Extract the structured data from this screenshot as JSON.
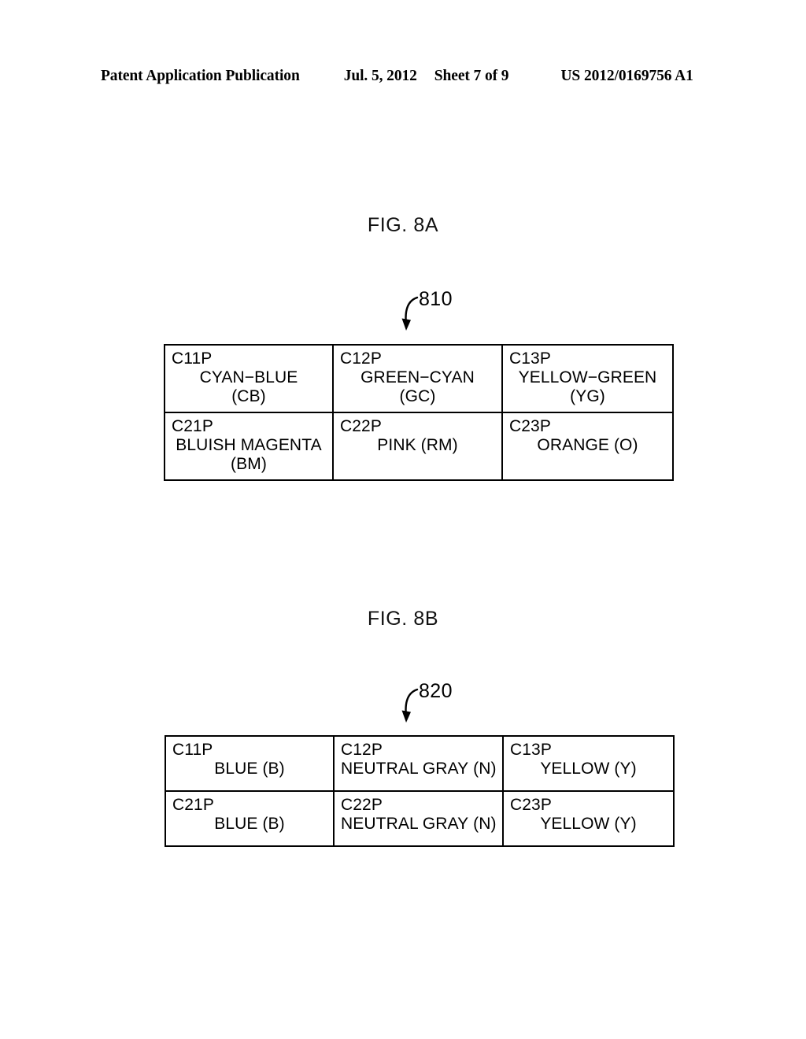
{
  "header": {
    "publication": "Patent Application Publication",
    "date": "Jul. 5, 2012",
    "sheet": "Sheet 7 of 9",
    "document_number": "US 2012/0169756 A1"
  },
  "figures": [
    {
      "title": "FIG. 8A",
      "reference_numeral": "810",
      "rows": [
        [
          {
            "code": "C11P",
            "value": "CYAN−BLUE",
            "abbr": "(CB)",
            "inline": false
          },
          {
            "code": "C12P",
            "value": "GREEN−CYAN",
            "abbr": "(GC)",
            "inline": false
          },
          {
            "code": "C13P",
            "value": "YELLOW−GREEN",
            "abbr": "(YG)",
            "inline": false
          }
        ],
        [
          {
            "code": "C21P",
            "value": "BLUISH MAGENTA",
            "abbr": "(BM)",
            "inline": false
          },
          {
            "code": "C22P",
            "value": "PINK",
            "abbr": "(RM)",
            "inline": true
          },
          {
            "code": "C23P",
            "value": "ORANGE",
            "abbr": "(O)",
            "inline": true
          }
        ]
      ]
    },
    {
      "title": "FIG. 8B",
      "reference_numeral": "820",
      "rows": [
        [
          {
            "code": "C11P",
            "value": "BLUE",
            "abbr": "(B)",
            "inline": true
          },
          {
            "code": "C12P",
            "value": "NEUTRAL GRAY",
            "abbr": "(N)",
            "inline": true
          },
          {
            "code": "C13P",
            "value": "YELLOW",
            "abbr": "(Y)",
            "inline": true
          }
        ],
        [
          {
            "code": "C21P",
            "value": "BLUE",
            "abbr": "(B)",
            "inline": true
          },
          {
            "code": "C22P",
            "value": "NEUTRAL GRAY",
            "abbr": "(N)",
            "inline": true
          },
          {
            "code": "C23P",
            "value": "YELLOW",
            "abbr": "(Y)",
            "inline": true
          }
        ]
      ]
    }
  ],
  "colors": {
    "ink": "#000000",
    "page": "#ffffff"
  }
}
